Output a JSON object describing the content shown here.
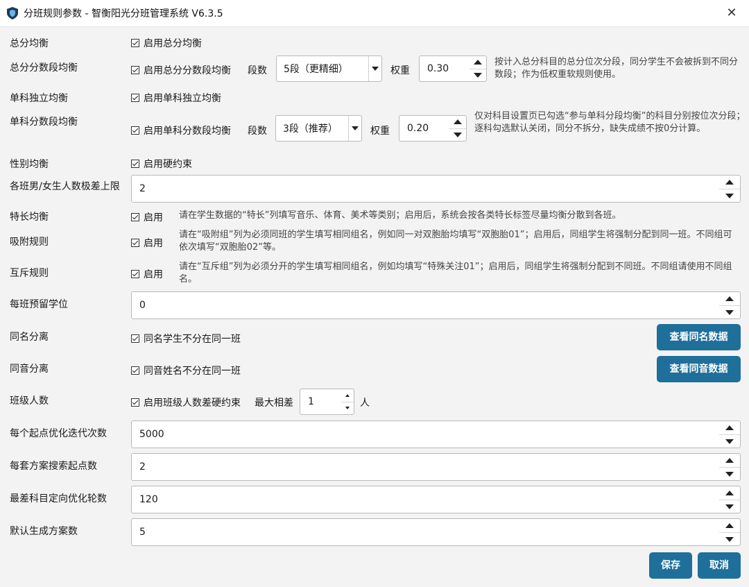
{
  "window": {
    "title": "分班规则参数 - 智衡阳光分班管理系统 V6.3.5",
    "close_glyph": "✕"
  },
  "rows": {
    "total_balance": {
      "label": "总分均衡",
      "checkbox": "启用总分均衡"
    },
    "total_segment": {
      "label": "总分分数段均衡",
      "checkbox": "启用总分分数段均衡",
      "segments_label": "段数",
      "segments_value": "5段（更精细）",
      "weight_label": "权重",
      "weight_value": "0.30",
      "desc": "按计入总分科目的总分位次分段，同分学生不会被拆到不同分数段；作为低权重软规则使用。"
    },
    "single_balance": {
      "label": "单科独立均衡",
      "checkbox": "启用单科独立均衡"
    },
    "single_segment": {
      "label": "单科分数段均衡",
      "checkbox": "启用单科分数段均衡",
      "segments_label": "段数",
      "segments_value": "3段（推荐）",
      "weight_label": "权重",
      "weight_value": "0.20",
      "desc": "仅对科目设置页已勾选“参与单科分段均衡”的科目分别按位次分段；逐科勾选默认关闭，同分不拆分，缺失成绩不按0分计算。"
    },
    "gender": {
      "label": "性别均衡",
      "checkbox": "启用硬约束"
    },
    "gender_diff": {
      "label": "各班男/女生人数极差上限",
      "value": "2"
    },
    "specialty": {
      "label": "特长均衡",
      "checkbox": "启用",
      "desc": "请在学生数据的“特长”列填写音乐、体育、美术等类别；启用后，系统会按各类特长标签尽量均衡分散到各班。"
    },
    "attach": {
      "label": "吸附规则",
      "checkbox": "启用",
      "desc": "请在“吸附组”列为必须同班的学生填写相同组名，例如同一对双胞胎均填写“双胞胎01”；启用后，同组学生将强制分配到同一班。不同组可依次填写“双胞胎02”等。"
    },
    "exclusive": {
      "label": "互斥规则",
      "checkbox": "启用",
      "desc": "请在“互斥组”列为必须分开的学生填写相同组名，例如均填写“特殊关注01”；启用后，同组学生将强制分配到不同班。不同组请使用不同组名。"
    },
    "reserve": {
      "label": "每班预留学位",
      "value": "0"
    },
    "same_name": {
      "label": "同名分离",
      "checkbox": "同名学生不分在同一班",
      "button": "查看同名数据"
    },
    "same_sound": {
      "label": "同音分离",
      "checkbox": "同音姓名不分在同一班",
      "button": "查看同音数据"
    },
    "class_size": {
      "label": "班级人数",
      "checkbox": "启用班级人数差硬约束",
      "max_label": "最大相差",
      "max_value": "1",
      "unit": "人"
    },
    "iterations": {
      "label": "每个起点优化迭代次数",
      "value": "5000"
    },
    "starts": {
      "label": "每套方案搜索起点数",
      "value": "2"
    },
    "worst_rounds": {
      "label": "最差科目定向优化轮数",
      "value": "120"
    },
    "plans": {
      "label": "默认生成方案数",
      "value": "5"
    }
  },
  "footer": {
    "save": "保存",
    "cancel": "取消"
  },
  "colors": {
    "accent": "#1f6f9b",
    "background": "#f3f3f3"
  }
}
